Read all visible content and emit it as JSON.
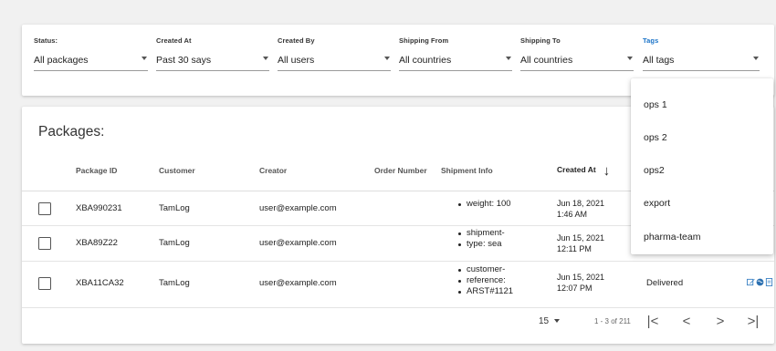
{
  "filters": [
    {
      "label": "Status:",
      "value": "All packages"
    },
    {
      "label": "Created At",
      "value": "Past 30 says"
    },
    {
      "label": "Created By",
      "value": "All users"
    },
    {
      "label": "Shipping From",
      "value": "All countries"
    },
    {
      "label": "Shipping To",
      "value": "All countries"
    },
    {
      "label": "Tags",
      "value": "All tags"
    }
  ],
  "colors": {
    "accent": "#1a73c8",
    "edit_icon": "#3b82c4",
    "globe_icon": "#2a6fb0"
  },
  "packages": {
    "title": "Packages:",
    "columns": {
      "package_id": "Package ID",
      "customer": "Customer",
      "creator": "Creator",
      "order_number": "Order Number",
      "shipment_info": "Shipment Info",
      "created_at": "Created At"
    },
    "rows": [
      {
        "package_id": "XBA990231",
        "customer": "TamLog",
        "creator": "user@example.com",
        "order_number": "",
        "shipment_info": [
          "weight: 100"
        ],
        "created_date": "Jun 18, 2021",
        "created_time": "1:46 AM",
        "status": ""
      },
      {
        "package_id": "XBA89Z22",
        "customer": "TamLog",
        "creator": "user@example.com",
        "order_number": "",
        "shipment_info": [
          "shipment-",
          "type: sea"
        ],
        "created_date": "Jun 15, 2021",
        "created_time": "12:11 PM",
        "status": ""
      },
      {
        "package_id": "XBA11CA32",
        "customer": "TamLog",
        "creator": "user@example.com",
        "order_number": "",
        "shipment_info": [
          "customer-",
          "reference:",
          "ARST#1121"
        ],
        "created_date": "Jun 15, 2021",
        "created_time": "12:07 PM",
        "status": "Delivered"
      }
    ]
  },
  "pagination": {
    "per_page": "15",
    "range": "1 - 3 of 211",
    "first": "|<",
    "prev": "<",
    "next": ">",
    "last": ">|"
  },
  "tags_menu": {
    "options": [
      "ops 1",
      "ops 2",
      "ops2",
      "export",
      "pharma-team"
    ]
  }
}
